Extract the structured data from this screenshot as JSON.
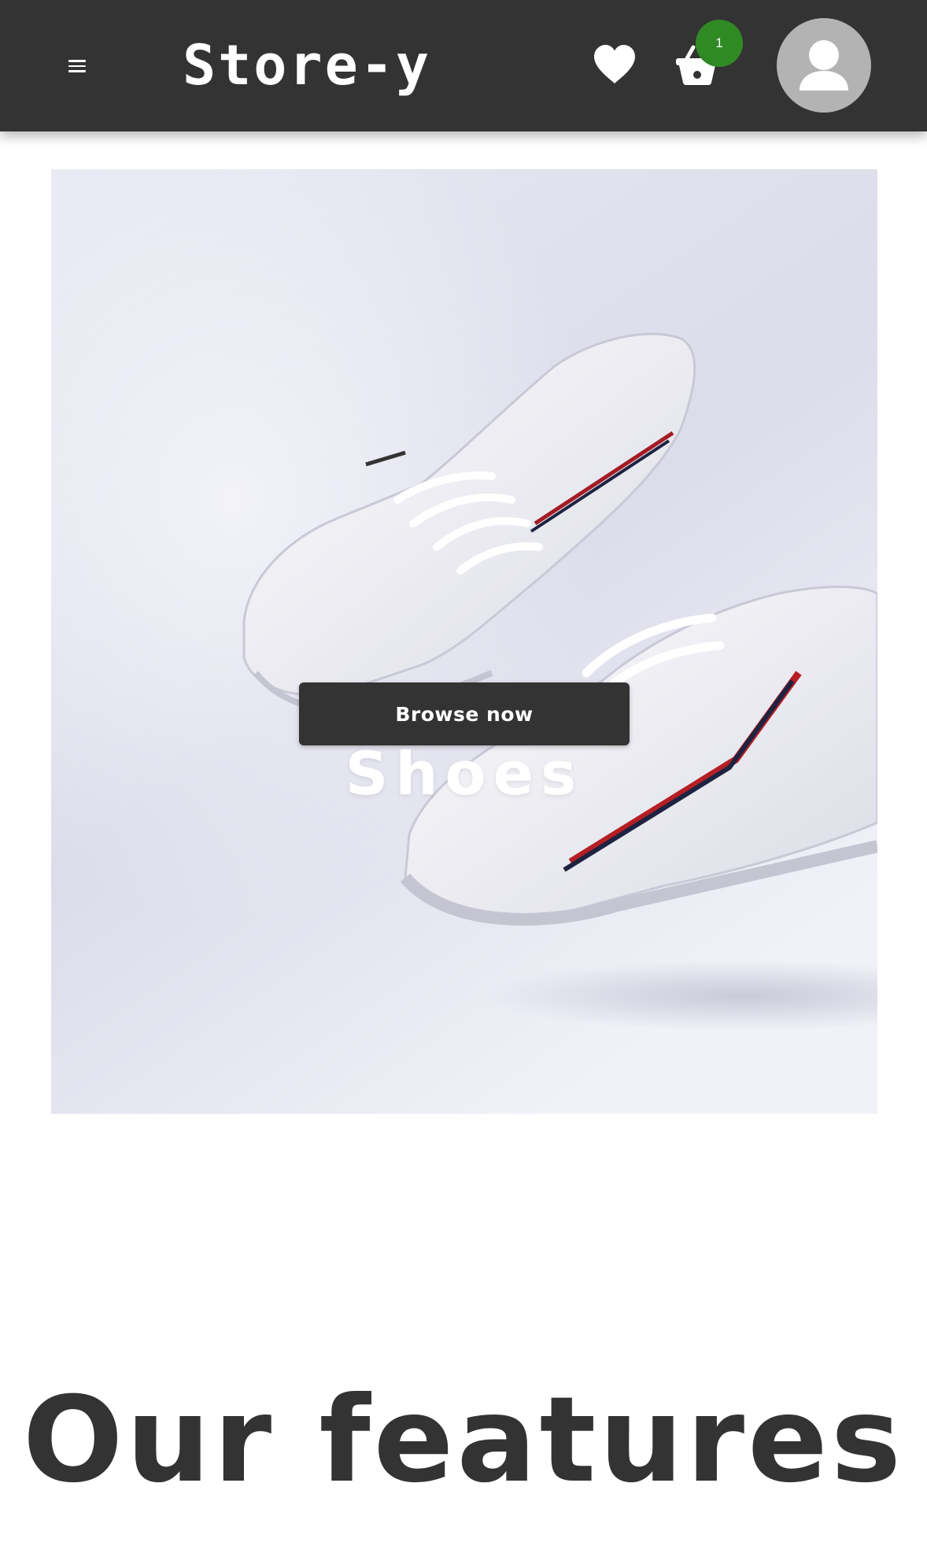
{
  "header": {
    "brand": "Store-y",
    "menu_icon": "hamburger-menu-icon",
    "wishlist_icon": "heart-icon",
    "cart_icon": "shopping-basket-icon",
    "cart_count": "1",
    "avatar_icon": "user-icon"
  },
  "hero": {
    "title": "Shoes",
    "button_label": "Browse now",
    "image": "white-sneakers-photo"
  },
  "features": {
    "heading": "Our features"
  },
  "colors": {
    "header_bg": "#333333",
    "badge": "#2f8a24",
    "avatar_bg": "#b3b3b3",
    "text_dark": "#333333",
    "page_bg": "#ffffff"
  }
}
